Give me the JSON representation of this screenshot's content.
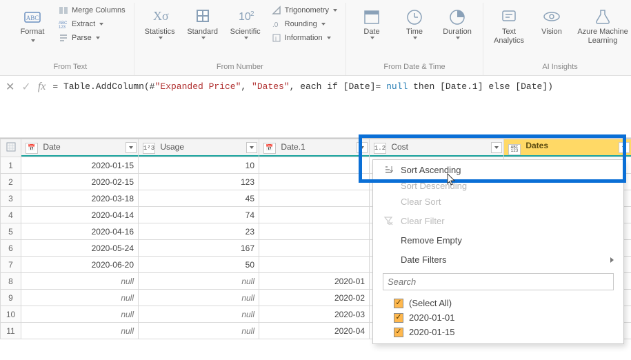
{
  "ribbon": {
    "groups": {
      "text": {
        "label": "From Text",
        "format": "Format",
        "merge": "Merge Columns",
        "extract": "Extract",
        "parse": "Parse"
      },
      "number": {
        "label": "From Number",
        "statistics": "Statistics",
        "standard": "Standard",
        "scientific": "Scientific",
        "trig": "Trigonometry",
        "rounding": "Rounding",
        "information": "Information"
      },
      "datetime": {
        "label": "From Date & Time",
        "date": "Date",
        "time": "Time",
        "duration": "Duration"
      },
      "ai": {
        "label": "AI Insights",
        "text_analytics": "Text Analytics",
        "vision": "Vision",
        "aml": "Azure Machine Learning"
      }
    }
  },
  "formula": {
    "prefix": "= Table.AddColumn(#",
    "arg1": "\"Expanded Price\"",
    "sep1": ", ",
    "arg2": "\"Dates\"",
    "sep2": ", each if [Date]= ",
    "nullkw": "null",
    "tail": " then [Date.1] else [Date])"
  },
  "columns": {
    "date": "Date",
    "usage": "Usage",
    "date1": "Date.1",
    "cost": "Cost",
    "dates": "Dates",
    "type_num": "1²₃",
    "type_dec": "1.2",
    "type_cal": "📅",
    "type_mixed": "ABC\n123"
  },
  "rows": [
    {
      "n": "1",
      "date": "2020-01-15",
      "usage": "10",
      "date1": "",
      "cost": "",
      "dates": ""
    },
    {
      "n": "2",
      "date": "2020-02-15",
      "usage": "123",
      "date1": "",
      "cost": "",
      "dates": ""
    },
    {
      "n": "3",
      "date": "2020-03-18",
      "usage": "45",
      "date1": "",
      "cost": "",
      "dates": ""
    },
    {
      "n": "4",
      "date": "2020-04-14",
      "usage": "74",
      "date1": "",
      "cost": "",
      "dates": ""
    },
    {
      "n": "5",
      "date": "2020-04-16",
      "usage": "23",
      "date1": "",
      "cost": "",
      "dates": ""
    },
    {
      "n": "6",
      "date": "2020-05-24",
      "usage": "167",
      "date1": "",
      "cost": "",
      "dates": ""
    },
    {
      "n": "7",
      "date": "2020-06-20",
      "usage": "50",
      "date1": "",
      "cost": "",
      "dates": ""
    },
    {
      "n": "8",
      "date": "null",
      "usage": "null",
      "date1": "2020-01",
      "cost": "",
      "dates": ""
    },
    {
      "n": "9",
      "date": "null",
      "usage": "null",
      "date1": "2020-02",
      "cost": "",
      "dates": ""
    },
    {
      "n": "10",
      "date": "null",
      "usage": "null",
      "date1": "2020-03",
      "cost": "",
      "dates": ""
    },
    {
      "n": "11",
      "date": "null",
      "usage": "null",
      "date1": "2020-04",
      "cost": "",
      "dates": ""
    }
  ],
  "filter_menu": {
    "sort_asc": "Sort Ascending",
    "sort_desc": "Sort Descending",
    "clear_sort": "Clear Sort",
    "clear_filter": "Clear Filter",
    "remove_empty": "Remove Empty",
    "date_filters": "Date Filters",
    "search_placeholder": "Search",
    "checks": [
      "(Select All)",
      "2020-01-01",
      "2020-01-15"
    ]
  }
}
